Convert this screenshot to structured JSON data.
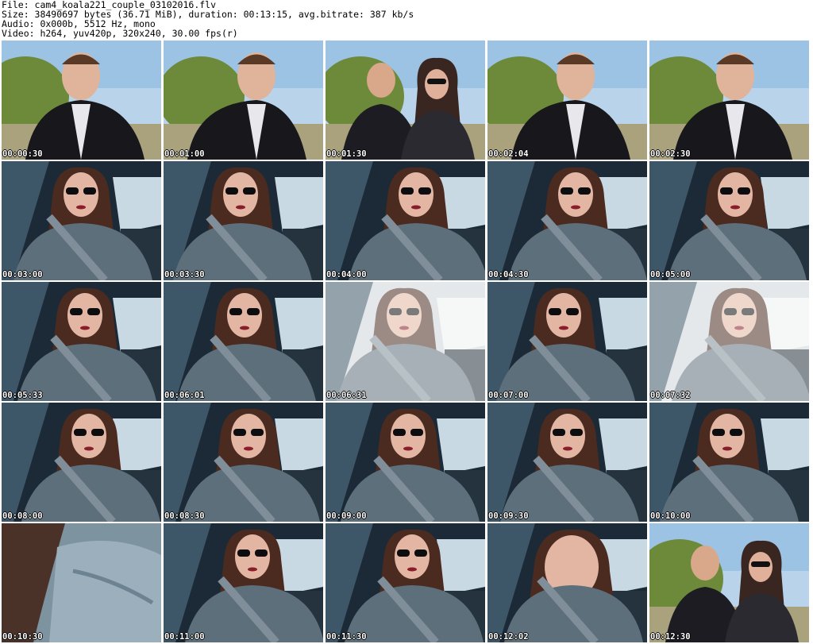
{
  "header": {
    "file_line": "File: cam4_koala221_couple_03102016.flv",
    "size_line": "Size: 38490697 bytes (36.71 MiB), duration: 00:13:15, avg.bitrate: 387 kb/s",
    "audio_line": "Audio: 0x000b, 5512 Hz, mono",
    "video_line": "Video: h264, yuv420p, 320x240, 30.00 fps(r)"
  },
  "thumbnails": [
    {
      "timestamp": "00:00:30",
      "scene": "outdoor-man"
    },
    {
      "timestamp": "00:01:00",
      "scene": "outdoor-man"
    },
    {
      "timestamp": "00:01:30",
      "scene": "outdoor-couple"
    },
    {
      "timestamp": "00:02:04",
      "scene": "outdoor-man"
    },
    {
      "timestamp": "00:02:30",
      "scene": "outdoor-man"
    },
    {
      "timestamp": "00:03:00",
      "scene": "car-woman"
    },
    {
      "timestamp": "00:03:30",
      "scene": "car-woman"
    },
    {
      "timestamp": "00:04:00",
      "scene": "car-woman"
    },
    {
      "timestamp": "00:04:30",
      "scene": "car-woman"
    },
    {
      "timestamp": "00:05:00",
      "scene": "car-woman"
    },
    {
      "timestamp": "00:05:33",
      "scene": "car-woman"
    },
    {
      "timestamp": "00:06:01",
      "scene": "car-woman"
    },
    {
      "timestamp": "00:06:31",
      "scene": "car-woman-glare"
    },
    {
      "timestamp": "00:07:00",
      "scene": "car-woman"
    },
    {
      "timestamp": "00:07:32",
      "scene": "car-woman-glare"
    },
    {
      "timestamp": "00:08:00",
      "scene": "car-woman"
    },
    {
      "timestamp": "00:08:30",
      "scene": "car-woman"
    },
    {
      "timestamp": "00:09:00",
      "scene": "car-woman"
    },
    {
      "timestamp": "00:09:30",
      "scene": "car-woman"
    },
    {
      "timestamp": "00:10:00",
      "scene": "car-woman"
    },
    {
      "timestamp": "00:10:30",
      "scene": "closeup-jacket"
    },
    {
      "timestamp": "00:11:00",
      "scene": "car-woman"
    },
    {
      "timestamp": "00:11:30",
      "scene": "car-woman"
    },
    {
      "timestamp": "00:12:02",
      "scene": "car-woman-closeup"
    },
    {
      "timestamp": "00:12:30",
      "scene": "outdoor-couple"
    }
  ]
}
